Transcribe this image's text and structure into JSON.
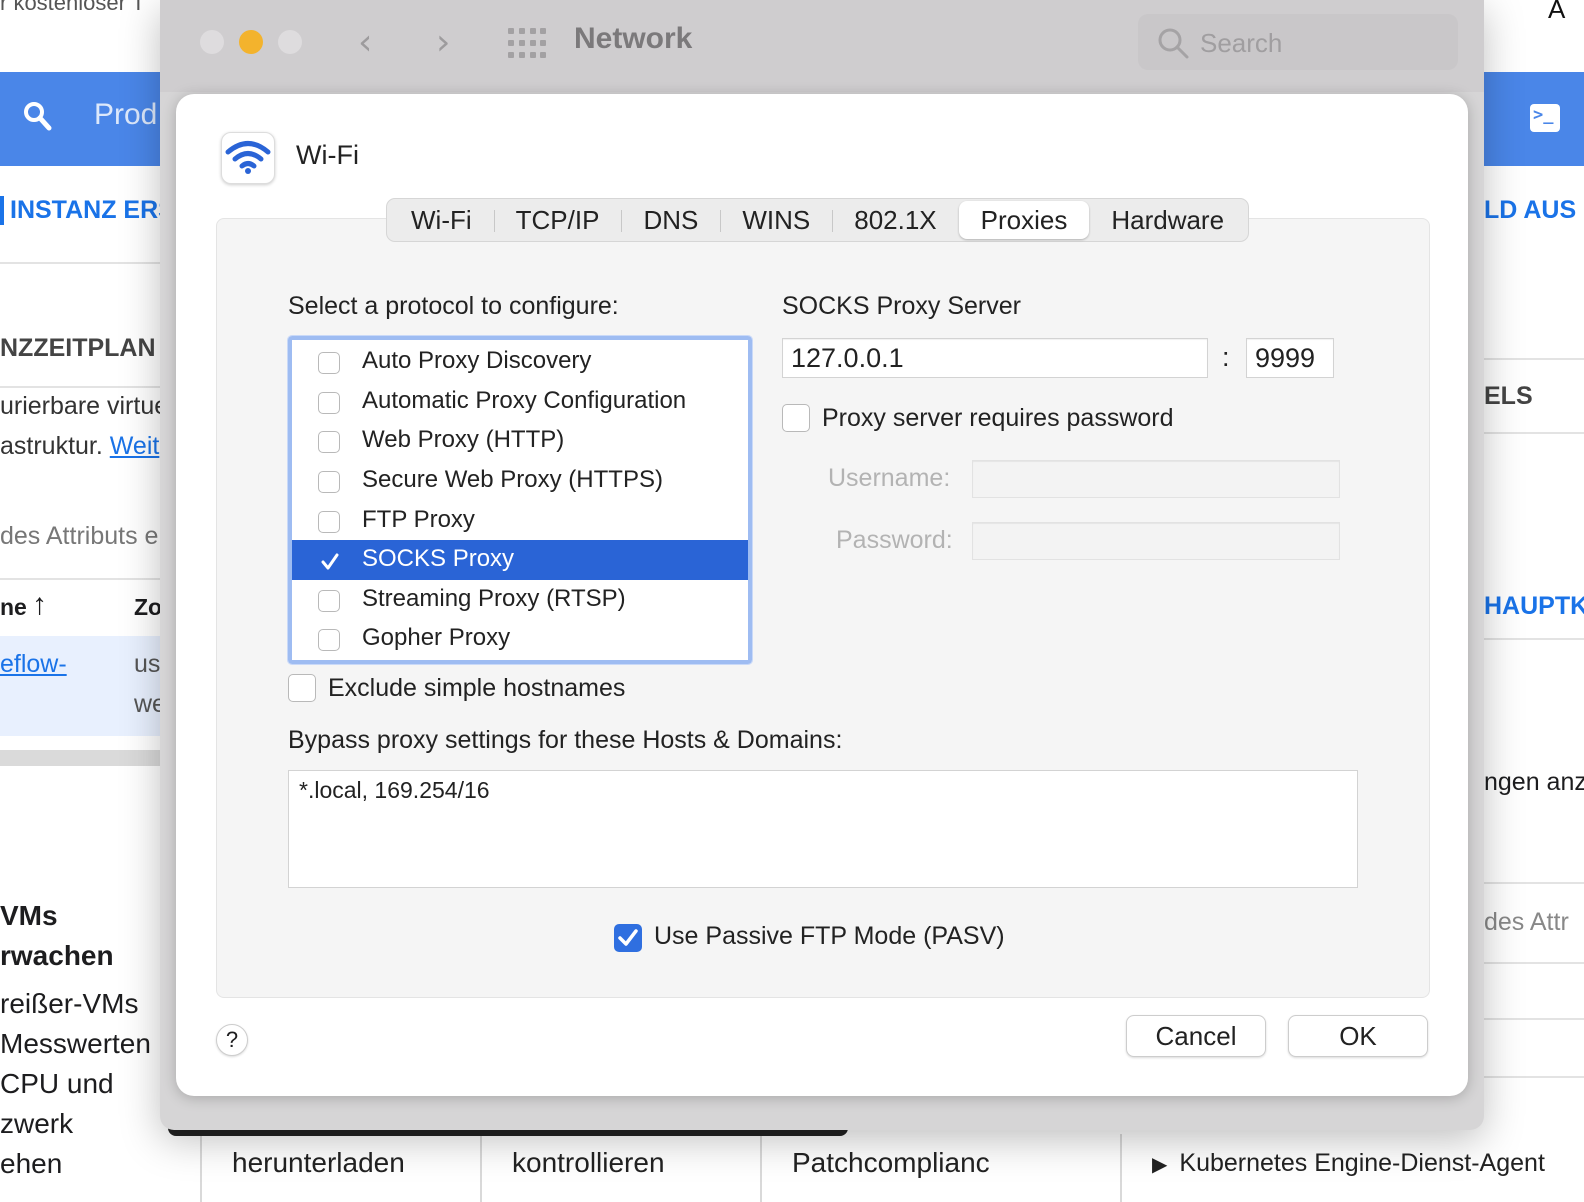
{
  "background_page": {
    "top_left_fragment": "r kostenloser T",
    "top_right_fragment": "A",
    "search_placeholder_fragment": "Prod",
    "link_instanz": "INSTANZ ERS",
    "link_right": "LD AUS",
    "section_zeitplan": "NZZEITPLAN",
    "text_line1": "urierbare virtue",
    "text_line2a": "astruktur. ",
    "text_line2_link": "Weit",
    "filter_hint": "des Attributs e",
    "col_name": "ne",
    "col_zone": "Zo",
    "row_link": "eflow-",
    "row_cell1": "us",
    "row_cell2": "we",
    "right_els": "ELS",
    "right_haupt": "HAUPTK",
    "right_gen": "ngen anz",
    "right_attr": "des Attr",
    "left_heading1": "VMs",
    "left_heading2": "rwachen",
    "left_p1": "reißer-VMs",
    "left_p2": "Messwerten",
    "left_p3": " CPU und",
    "left_p4": "zwerk",
    "left_p5": "ehen",
    "bottom_cells": [
      "herunterladen",
      "kontrollieren",
      "Patchcomplianc"
    ],
    "bottom_right_item": "Kubernetes Engine-Dienst-Agent"
  },
  "window": {
    "title": "Network",
    "search_placeholder": "Search"
  },
  "sheet": {
    "service_name": "Wi-Fi",
    "tabs": [
      "Wi-Fi",
      "TCP/IP",
      "DNS",
      "WINS",
      "802.1X",
      "Proxies",
      "Hardware"
    ],
    "selected_tab": "Proxies",
    "protocol_label": "Select a protocol to configure:",
    "protocols": [
      {
        "label": "Auto Proxy Discovery",
        "checked": false,
        "selected": false
      },
      {
        "label": "Automatic Proxy Configuration",
        "checked": false,
        "selected": false
      },
      {
        "label": "Web Proxy (HTTP)",
        "checked": false,
        "selected": false
      },
      {
        "label": "Secure Web Proxy (HTTPS)",
        "checked": false,
        "selected": false
      },
      {
        "label": "FTP Proxy",
        "checked": false,
        "selected": false
      },
      {
        "label": "SOCKS Proxy",
        "checked": true,
        "selected": true
      },
      {
        "label": "Streaming Proxy (RTSP)",
        "checked": false,
        "selected": false
      },
      {
        "label": "Gopher Proxy",
        "checked": false,
        "selected": false
      }
    ],
    "server_heading": "SOCKS Proxy Server",
    "server_host": "127.0.0.1",
    "port_separator": ":",
    "server_port": "9999",
    "requires_password_label": "Proxy server requires password",
    "requires_password_checked": false,
    "username_label": "Username:",
    "username_value": "",
    "password_label": "Password:",
    "password_value": "",
    "exclude_simple_label": "Exclude simple hostnames",
    "exclude_simple_checked": false,
    "bypass_label": "Bypass proxy settings for these Hosts & Domains:",
    "bypass_value": "*.local, 169.254/16",
    "passive_ftp_label": "Use Passive FTP Mode (PASV)",
    "passive_ftp_checked": true,
    "help_label": "?",
    "cancel_label": "Cancel",
    "ok_label": "OK"
  },
  "colors": {
    "accent": "#2a64d6",
    "checkbox_blue": "#2f6fe0",
    "bg_page_bar": "#4a86e8",
    "traffic_light_minimize": "#f3b32d"
  },
  "icons": {
    "wifi": "wifi-icon",
    "search": "search-icon",
    "grid": "grid-icon",
    "back": "chevron-left-icon",
    "forward": "chevron-right-icon",
    "checkmark": "checkmark-icon"
  }
}
